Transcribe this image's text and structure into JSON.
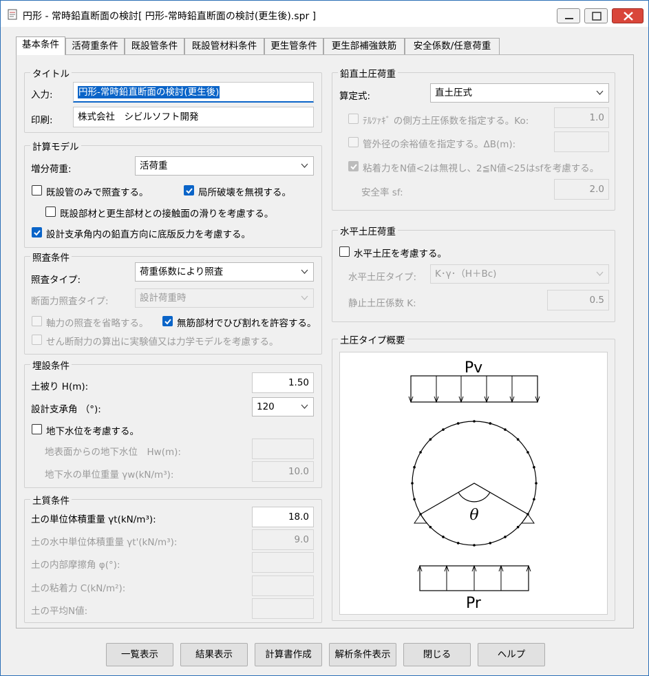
{
  "window": {
    "title": "円形 - 常時鉛直断面の検討[ 円形-常時鉛直断面の検討(更生後).spr ]"
  },
  "tabs": [
    {
      "label": "基本条件"
    },
    {
      "label": "活荷重条件"
    },
    {
      "label": "既設管条件"
    },
    {
      "label": "既設管材料条件"
    },
    {
      "label": "更生管条件"
    },
    {
      "label": "更生部補強鉄筋"
    },
    {
      "label": "安全係数/任意荷重"
    }
  ],
  "title_group": {
    "legend": "タイトル",
    "input_label": "入力:",
    "input_value": "円形-常時鉛直断面の検討(更生後)",
    "print_label": "印刷:",
    "print_value": "株式会社　シビルソフト開発"
  },
  "calc_model": {
    "legend": "計算モデル",
    "increment_label": "増分荷重:",
    "increment_value": "活荷重",
    "cb_existing_only": "既設管のみで照査する。",
    "cb_ignore_local": "局所破壊を無視する。",
    "cb_slip": "既設部材と更生部材との接触面の滑りを考慮する。",
    "cb_bottom_reaction": "設計支承角内の鉛直方向に底版反力を考慮する。"
  },
  "check": {
    "legend": "照査条件",
    "type_label": "照査タイプ:",
    "type_value": "荷重係数により照査",
    "section_label": "断面力照査タイプ:",
    "section_value": "設計荷重時",
    "cb_axial": "軸力の照査を省略する。",
    "cb_crack": "無筋部材でひび割れを許容する。",
    "cb_shear": "せん断耐力の算出に実験値又は力学モデルを考慮する。"
  },
  "burial": {
    "legend": "埋設条件",
    "cover_label": "土被り H(m):",
    "cover_value": "1.50",
    "angle_label": "設計支承角 （°):",
    "angle_value": "120",
    "cb_groundwater": "地下水位を考慮する。",
    "gw_depth_label": "地表面からの地下水位　Hw(m):",
    "gw_depth_value": "",
    "gw_weight_label": "地下水の単位重量 γw(kN/m³):",
    "gw_weight_value": "10.0"
  },
  "soil": {
    "legend": "土質条件",
    "unit_weight_label": "土の単位体積重量 γt(kN/m³):",
    "unit_weight_value": "18.0",
    "sub_weight_label": "土の水中単位体積重量 γt'(kN/m³):",
    "sub_weight_value": "9.0",
    "friction_label": "土の内部摩擦角 φ(°):",
    "cohesion_label": "土の粘着力 C(kN/m²):",
    "n_value_label": "土の平均N値:"
  },
  "vertical_pressure": {
    "legend": "鉛直土圧荷重",
    "formula_label": "算定式:",
    "formula_value": "直土圧式",
    "cb_terzaghi": "ﾃﾙﾂｧｷﾞ の側方土圧係数を指定する。Ko:",
    "terzaghi_value": "1.0",
    "cb_margin": "管外径の余裕値を指定する。ΔB(m):",
    "cb_cohesion": "粘着力をN値<2は無視し、2≦N値<25はsfを考慮する。",
    "sf_label": "安全率 sf:",
    "sf_value": "2.0"
  },
  "horizontal_pressure": {
    "legend": "水平土圧荷重",
    "cb_consider": "水平土圧を考慮する。",
    "type_label": "水平土圧タイプ:",
    "type_value": "K･γ･（H＋Bc)",
    "coef_label": "静止土圧係数 K:",
    "coef_value": "0.5"
  },
  "overview": {
    "legend": "土圧タイプ概要",
    "pv": "Pv",
    "pr": "Pr",
    "theta": "θ"
  },
  "buttons": {
    "list": "一覧表示",
    "results": "結果表示",
    "report": "計算書作成",
    "analysis": "解析条件表示",
    "close": "閉じる",
    "help": "ヘルプ"
  }
}
